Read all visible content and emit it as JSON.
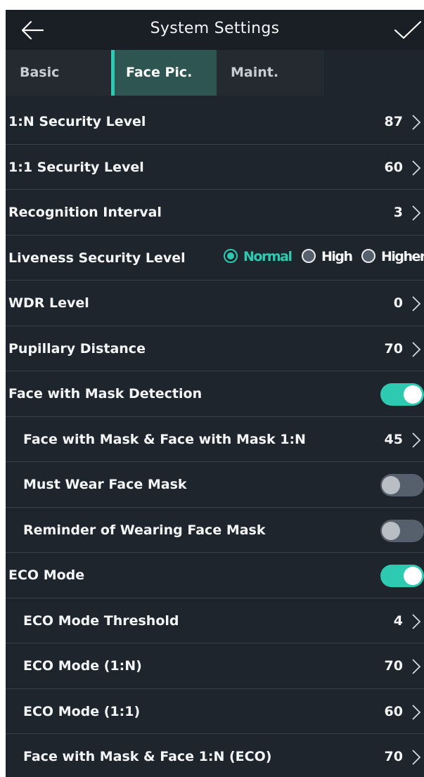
{
  "header": {
    "title": "System Settings",
    "back_icon": "arrow-left-icon",
    "confirm_icon": "checkmark-icon"
  },
  "tabs": [
    {
      "label": "Basic",
      "active": false
    },
    {
      "label": "Face Pic.",
      "active": true
    },
    {
      "label": "Maint.",
      "active": false
    }
  ],
  "rows": {
    "security_1n": {
      "label": "1:N Security Level",
      "value": "87"
    },
    "security_11": {
      "label": "1:1 Security Level",
      "value": "60"
    },
    "recognition_interval": {
      "label": "Recognition Interval",
      "value": "3"
    },
    "liveness": {
      "label": "Liveness Security Level",
      "options": [
        "Normal",
        "High",
        "Higher"
      ],
      "selected": "Normal"
    },
    "wdr": {
      "label": "WDR Level",
      "value": "0"
    },
    "pupillary": {
      "label": "Pupillary Distance",
      "value": "70"
    },
    "mask_detection": {
      "label": "Face with Mask Detection",
      "enabled": true
    },
    "mask_1n": {
      "label": "Face with Mask & Face with Mask 1:N",
      "value": "45"
    },
    "must_wear": {
      "label": "Must Wear Face Mask",
      "enabled": false
    },
    "reminder": {
      "label": "Reminder of Wearing Face Mask",
      "enabled": false
    },
    "eco_mode": {
      "label": "ECO Mode",
      "enabled": true
    },
    "eco_threshold": {
      "label": "ECO Mode Threshold",
      "value": "4"
    },
    "eco_1n": {
      "label": "ECO Mode (1:N)",
      "value": "70"
    },
    "eco_11": {
      "label": "ECO Mode (1:1)",
      "value": "60"
    },
    "mask_face_1n_eco": {
      "label": "Face with Mask & Face 1:N (ECO)",
      "value": "70"
    }
  },
  "colors": {
    "accent": "#2ec9b1",
    "background": "#1f252c",
    "header_bg": "#1a1f25",
    "tab_active_bg": "#2f5552",
    "divider": "#39414a",
    "toggle_off": "#56606c"
  }
}
